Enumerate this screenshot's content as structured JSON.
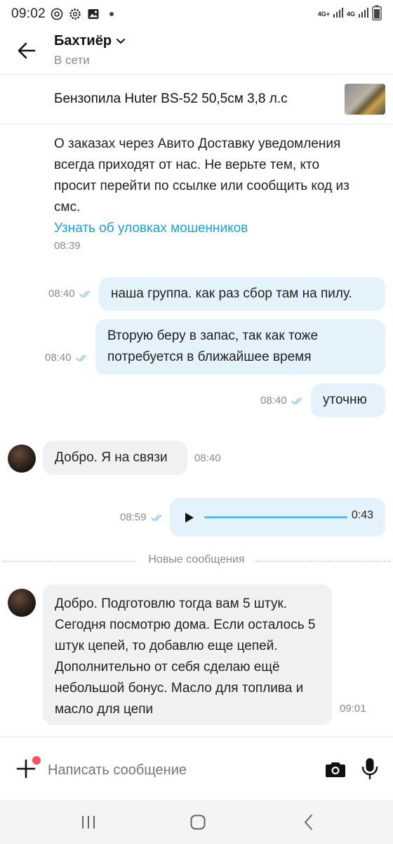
{
  "status_bar": {
    "time": "09:02",
    "net1": "4G+",
    "net2": "4G",
    "icons": [
      "at-icon",
      "gear-icon",
      "gallery-icon",
      "dot-icon",
      "signal-icon",
      "battery-icon"
    ]
  },
  "header": {
    "name": "Бахтиёр",
    "status": "В сети"
  },
  "item": {
    "title": "Бензопила Huter BS-52 50,5см 3,8 л.с"
  },
  "notice": {
    "text": "О заказах через Авито Доставку уведомления всегда приходят от нас. Не верьте тем, кто просит перейти по ссылке или сообщить код из смс.",
    "link": "Узнать об уловках мошенников",
    "time": "08:39"
  },
  "messages": [
    {
      "dir": "out",
      "text": "наша группа. как раз сбор там на пилу.",
      "time": "08:40"
    },
    {
      "dir": "out",
      "text": "Вторую беру в запас, так как тоже потребуется в ближайшее время",
      "time": "08:40"
    },
    {
      "dir": "out",
      "text": "уточню",
      "time": "08:40"
    },
    {
      "dir": "in",
      "text": "Добро. Я на связи",
      "time": "08:40"
    },
    {
      "dir": "in",
      "text": "Добро. Подготовлю тогда вам 5 штук. Сегодня посмотрю дома. Если осталось 5 штук цепей, то добавлю еще цепей. Дополнительно от себя сделаю ещё небольшой бонус. Масло для топлива и масло для цепи",
      "time": "09:01"
    }
  ],
  "voice": {
    "time": "08:59",
    "duration": "0:43"
  },
  "divider": {
    "label": "Новые сообщения"
  },
  "composer": {
    "placeholder": "Написать сообщение"
  },
  "colors": {
    "out_bubble": "#e4f3fb",
    "in_bubble": "#f1f1f3",
    "link": "#1aa0dc",
    "read_check": "#8fc9e8",
    "badge": "#ff4f5e"
  }
}
